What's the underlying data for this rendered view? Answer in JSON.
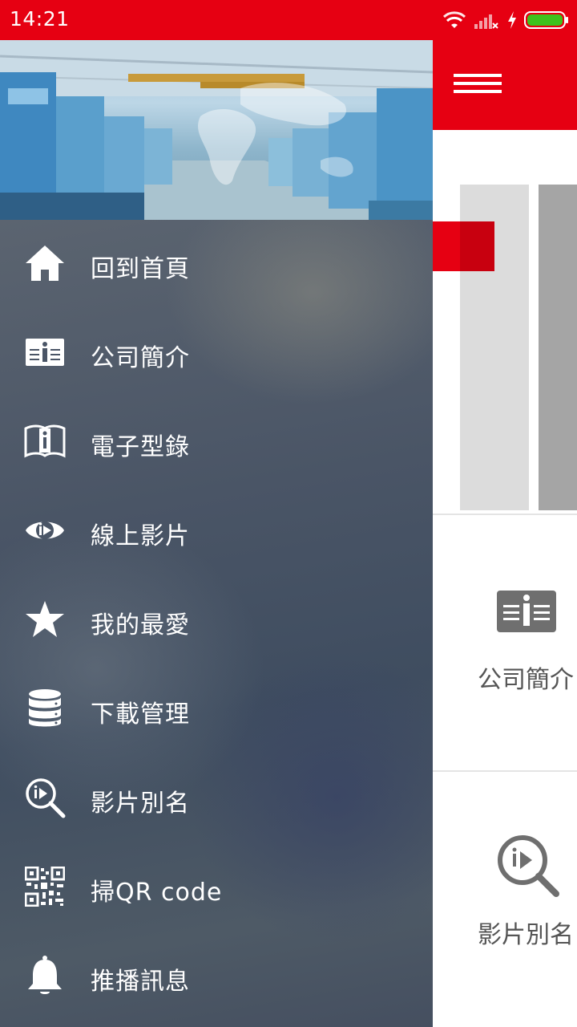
{
  "status_bar": {
    "time": "14:21"
  },
  "colors": {
    "brand_red": "#e60012",
    "drawer_text": "#ffffff",
    "battery_green": "#3ec21c"
  },
  "drawer": {
    "menu": [
      {
        "label": "回到首頁",
        "icon": "home-icon"
      },
      {
        "label": "公司簡介",
        "icon": "info-book-icon"
      },
      {
        "label": "電子型錄",
        "icon": "catalog-book-icon"
      },
      {
        "label": "線上影片",
        "icon": "eye-play-icon"
      },
      {
        "label": "我的最愛",
        "icon": "star-icon"
      },
      {
        "label": "下載管理",
        "icon": "database-icon"
      },
      {
        "label": "影片別名",
        "icon": "search-play-icon"
      },
      {
        "label": "掃QR code",
        "icon": "qr-code-icon"
      },
      {
        "label": "推播訊息",
        "icon": "bell-icon"
      }
    ]
  },
  "background_app": {
    "cards": [
      {
        "label": "公司簡介",
        "icon": "info-book-icon"
      },
      {
        "label": "影片別名",
        "icon": "search-play-icon"
      }
    ]
  }
}
